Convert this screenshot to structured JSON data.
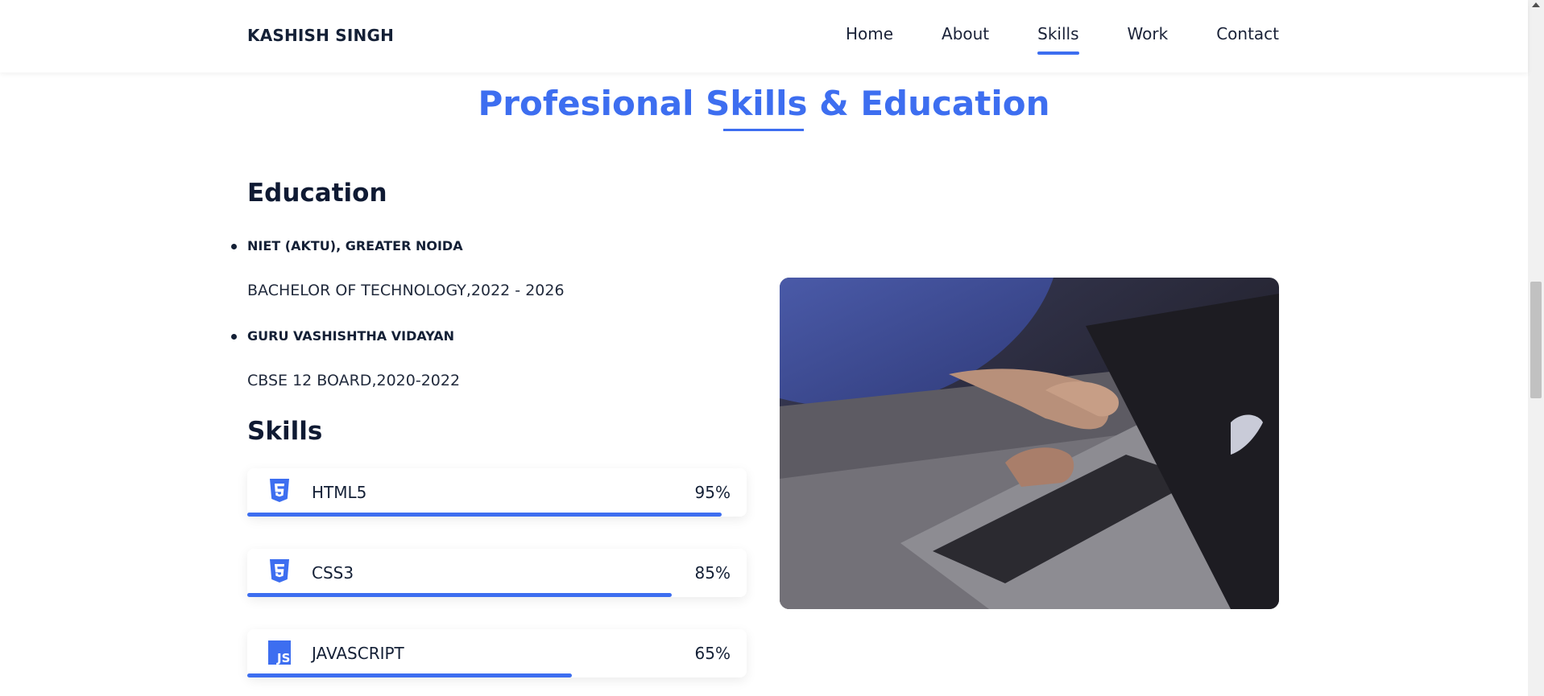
{
  "header": {
    "brand": "KASHISH SINGH",
    "nav": [
      "Home",
      "About",
      "Skills",
      "Work",
      "Contact"
    ],
    "active_nav": "Skills"
  },
  "section": {
    "title": "Profesional Skills & Education"
  },
  "education": {
    "heading": "Education",
    "items": [
      {
        "school": "NIET (AKTU), GREATER NOIDA",
        "degree": "BACHELOR OF TECHNOLOGY,2022 - 2026"
      },
      {
        "school": "GURU VASHISHTHA VIDAYAN",
        "degree": "CBSE 12 BOARD,2020-2022"
      }
    ]
  },
  "skills": {
    "heading": "Skills",
    "items": [
      {
        "name": "HTML5",
        "percent_label": "95%",
        "percent": 95,
        "icon": "html5-icon"
      },
      {
        "name": "CSS3",
        "percent_label": "85%",
        "percent": 85,
        "icon": "css3-icon"
      },
      {
        "name": "JAVASCRIPT",
        "percent_label": "65%",
        "percent": 65,
        "icon": "javascript-icon"
      }
    ]
  },
  "colors": {
    "accent": "#3d6ef0",
    "text": "#142036"
  },
  "image": {
    "subject": "laptop-typing-photo"
  }
}
